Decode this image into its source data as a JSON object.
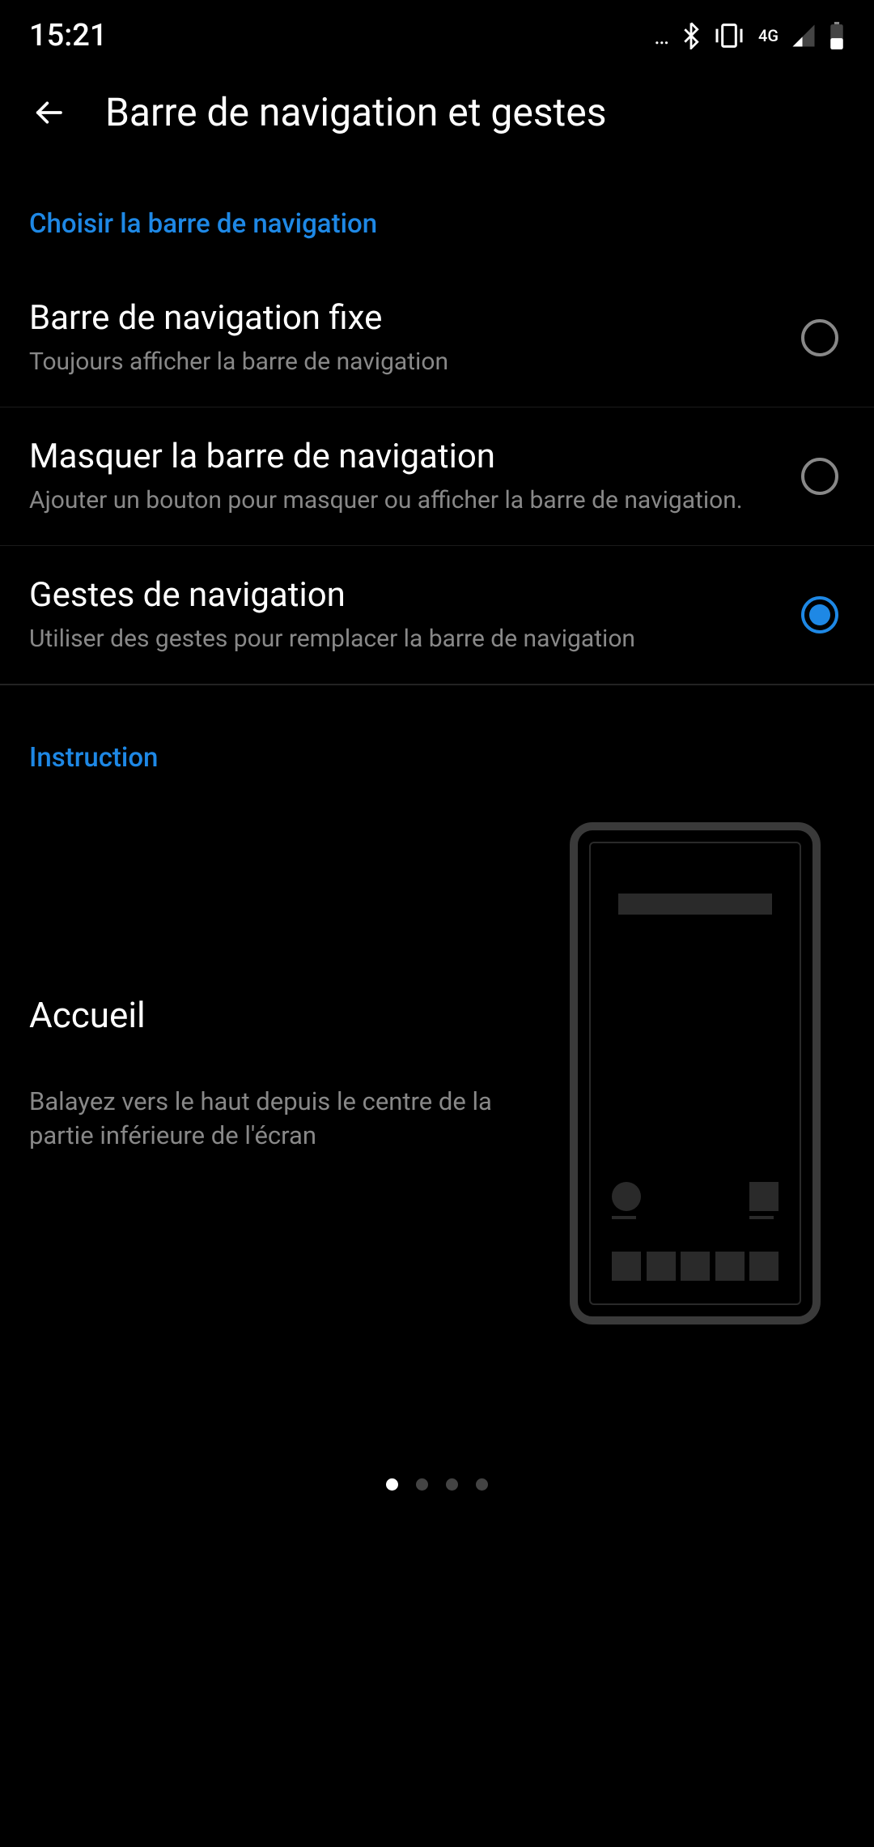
{
  "status_bar": {
    "time": "15:21",
    "network_type": "4G"
  },
  "header": {
    "title": "Barre de navigation et gestes"
  },
  "sections": {
    "choose_nav": {
      "title": "Choisir la barre de navigation",
      "options": [
        {
          "title": "Barre de navigation fixe",
          "subtitle": "Toujours afficher la barre de navigation",
          "selected": false
        },
        {
          "title": "Masquer la barre de navigation",
          "subtitle": "Ajouter un bouton pour masquer ou afficher la barre de navigation.",
          "selected": false
        },
        {
          "title": "Gestes de navigation",
          "subtitle": "Utiliser des gestes pour remplacer la barre de navigation",
          "selected": true
        }
      ]
    },
    "instruction": {
      "title": "Instruction",
      "gesture_title": "Accueil",
      "gesture_desc": "Balayez vers le haut depuis le centre de la partie inférieure de l'écran"
    }
  },
  "pager": {
    "count": 4,
    "active": 0
  },
  "colors": {
    "accent": "#1E88E5",
    "background": "#000000",
    "text_primary": "#ffffff",
    "text_secondary": "#888888"
  }
}
